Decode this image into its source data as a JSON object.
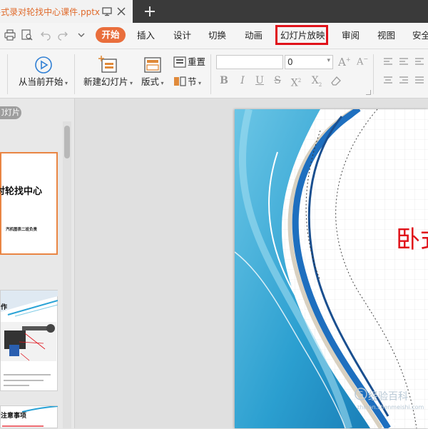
{
  "tab": {
    "title": "卧式录对轮找中心课件.pptx"
  },
  "menu": {
    "start": "开始",
    "insert": "插入",
    "design": "设计",
    "transition": "切换",
    "animation": "动画",
    "slideshow": "幻灯片放映",
    "review": "审阅",
    "view": "视图",
    "security": "安全"
  },
  "ribbon": {
    "play_from_current": "从当前开始",
    "new_slide": "新建幻灯片",
    "layout": "版式",
    "reset": "重置",
    "section": "节",
    "font_size_value": "0"
  },
  "panel": {
    "tab_label": "幻灯片",
    "slide1_title": "对轮找中心",
    "slide1_subtitle": "汽机图表二班负责",
    "slide2_title": "作",
    "slide3_title": "注意事项"
  },
  "slide": {
    "title_visible": "卧式"
  },
  "watermark": {
    "brand": "S",
    "text": "经验百科",
    "sub": "zhinan.shenmeishi.com"
  },
  "colors": {
    "accent": "#e96e3c",
    "highlight": "#e0121a",
    "title_red": "#e0121a",
    "selected_border": "#e98543",
    "tab_text": "#e06a2b"
  }
}
